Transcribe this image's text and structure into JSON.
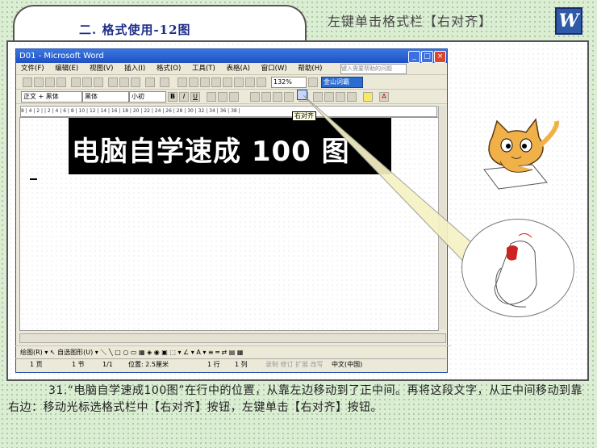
{
  "header": {
    "section_title": "二. 格式使用-12图",
    "subtitle": "左键单击格式栏【右对齐】",
    "logo_letter": "W"
  },
  "word_window": {
    "title": "D01 - Microsoft Word",
    "menu_items": [
      "文件(F)",
      "编辑(E)",
      "视图(V)",
      "插入(I)",
      "格式(O)",
      "工具(T)",
      "表格(A)",
      "窗口(W)",
      "帮助(H)"
    ],
    "ask_box_placeholder": "键入需要帮助的问题",
    "zoom": "132%",
    "jinshan_label": "金山词霸",
    "style_box": "正文 + 黑体",
    "font_box": "黑体",
    "size_box": "小初",
    "ruler_text": "8 | 4 | 2 | | 2 | 4 | 6 | 8 | 10 | 12 | 14 | 16 | 18 | 20 | 22 | 24 | 26 | 28 | 30 | 32 | 34 | 36 | 38 |",
    "banner_text": "电脑自学速成 100 图",
    "tooltip": "右对齐",
    "draw_toolbar": "绘图(R) ▾  ↖  自选图形(U) ▾  ＼ ╲ □ ○ ▭ ▦ ◈ ◉ ▣  ⬚ ▾ ∠ ▾ A ▾ ≡ ═ ⇄ ▤ ▦",
    "status": {
      "page": "1 页",
      "section": "1 节",
      "pages": "1/1",
      "position": "位置: 2.5厘米",
      "line": "1 行",
      "column": "1 列",
      "modes": "录制  修订  扩展  改写",
      "language": "中文(中国)"
    }
  },
  "caption": "31.“电脑自学速成100图”在行中的位置，从靠左边移动到了正中间。再将这段文字，从正中间移动到靠右边：移动光标选格式栏中【右对齐】按钮，左键单击【右对齐】按钮。",
  "colors": {
    "title_blue": "#1e2f8a",
    "beam_yellow": "#f4f0b0"
  }
}
